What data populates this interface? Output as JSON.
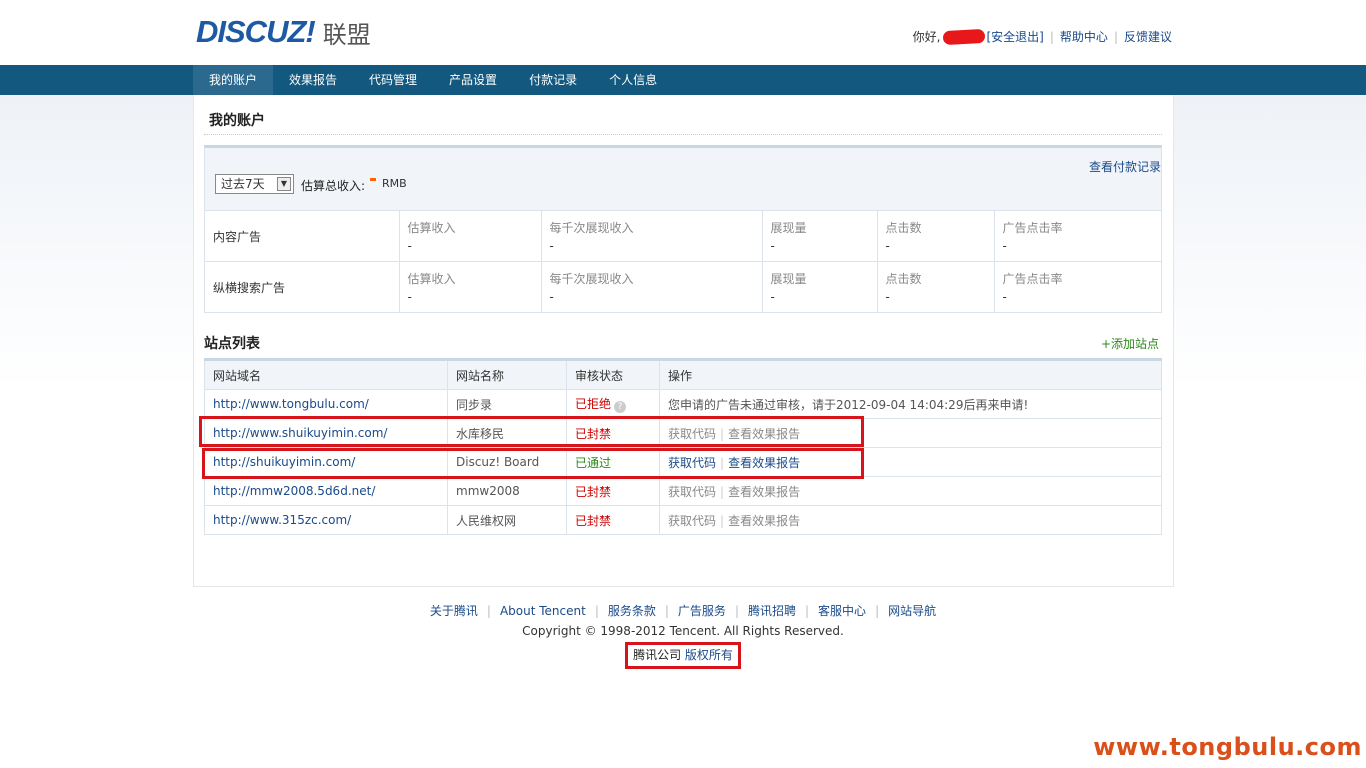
{
  "header": {
    "logo_text": "DISCUZ!",
    "logo_cn": "联盟",
    "greeting": "你好,",
    "logout": "[安全退出]",
    "help": "帮助中心",
    "feedback": "反馈建议",
    "sep": "|"
  },
  "nav": [
    "我的账户",
    "效果报告",
    "代码管理",
    "产品设置",
    "付款记录",
    "个人信息"
  ],
  "page_title": "我的账户",
  "summary": {
    "view_payments": "查看付款记录",
    "period": "过去7天",
    "period_arrow": "▼",
    "total_label": "估算总收入:",
    "currency": "RMB",
    "rows": [
      {
        "name": "内容广告",
        "cols": [
          {
            "label": "估算收入",
            "value": "-"
          },
          {
            "label": "每千次展现收入",
            "value": "-"
          },
          {
            "label": "展现量",
            "value": "-"
          },
          {
            "label": "点击数",
            "value": "-"
          },
          {
            "label": "广告点击率",
            "value": "-"
          }
        ]
      },
      {
        "name": "纵横搜索广告",
        "cols": [
          {
            "label": "估算收入",
            "value": "-"
          },
          {
            "label": "每千次展现收入",
            "value": "-"
          },
          {
            "label": "展现量",
            "value": "-"
          },
          {
            "label": "点击数",
            "value": "-"
          },
          {
            "label": "广告点击率",
            "value": "-"
          }
        ]
      }
    ]
  },
  "sites": {
    "title": "站点列表",
    "add_site": "+添加站点",
    "headers": [
      "网站域名",
      "网站名称",
      "审核状态",
      "操作"
    ],
    "rows": [
      {
        "domain": "http://www.tongbulu.com/",
        "name": "同步录",
        "status": "已拒绝",
        "help_icon": "?",
        "note": "您申请的广告未通过审核，请于2012-09-04 14:04:29后再来申请!"
      },
      {
        "domain": "http://www.shuikuyimin.com/",
        "name": "水库移民",
        "status": "已封禁",
        "get_code": "获取代码",
        "view_report": "查看效果报告"
      },
      {
        "domain": "http://shuikuyimin.com/",
        "name": "Discuz! Board",
        "status": "已通过",
        "get_code": "获取代码",
        "view_report": "查看效果报告"
      },
      {
        "domain": "http://mmw2008.5d6d.net/",
        "name": "mmw2008",
        "status": "已封禁",
        "get_code": "获取代码",
        "view_report": "查看效果报告"
      },
      {
        "domain": "http://www.315zc.com/",
        "name": "人民维权网",
        "status": "已封禁",
        "get_code": "获取代码",
        "view_report": "查看效果报告"
      }
    ]
  },
  "footer": {
    "links": [
      "关于腾讯",
      "About Tencent",
      "服务条款",
      "广告服务",
      "腾讯招聘",
      "客服中心",
      "网站导航"
    ],
    "sep": "|",
    "copyright": "Copyright © 1998-2012 Tencent. All Rights Reserved.",
    "company": "腾讯公司",
    "rights": "版权所有"
  },
  "watermark": "www.tongbulu.com",
  "colors": {
    "nav_bg": "#13587e",
    "link": "#1a4a8a",
    "status_red": "#c00",
    "status_green": "#2a8a1a",
    "highlight_red": "#d7141a"
  }
}
